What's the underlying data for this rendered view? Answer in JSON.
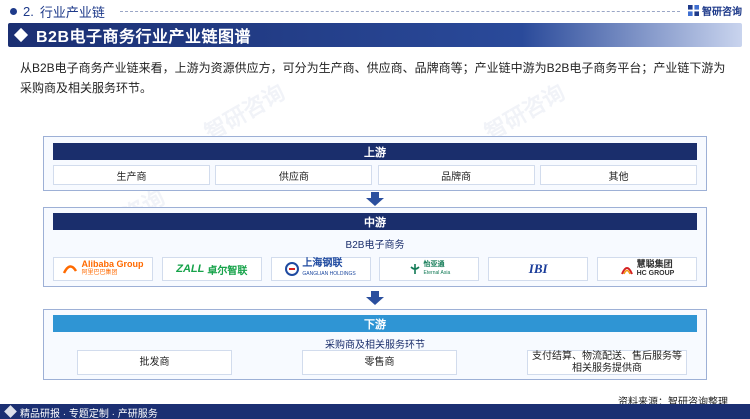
{
  "header": {
    "section_number": "2.",
    "section_title": "行业产业链",
    "brand": "智研咨询"
  },
  "title": "B2B电子商务行业产业链图谱",
  "intro": "从B2B电子商务产业链来看，上游为资源供应方，可分为生产商、供应商、品牌商等；产业链中游为B2B电子商务平台；产业链下游为采购商及相关服务环节。",
  "upstream": {
    "label": "上游",
    "items": [
      "生产商",
      "供应商",
      "品牌商",
      "其他"
    ]
  },
  "midstream": {
    "label": "中游",
    "sublabel": "B2B电子商务",
    "logos": [
      {
        "name": "Alibaba Group",
        "sub": "阿里巴巴集团",
        "color": "#ff6a00"
      },
      {
        "name": "ZALL",
        "sub": "卓尔智联",
        "color": "#17a34a"
      },
      {
        "name": "上海钢联",
        "sub": "GANGLIAN HOLDINGS",
        "color": "#1f4aa0"
      },
      {
        "name": "怡亚通",
        "sub": "Eternal Asia",
        "color": "#117a55"
      },
      {
        "name": "IBI",
        "sub": "",
        "color": "#1a3c9a"
      },
      {
        "name": "慧聪集团",
        "sub": "HC GROUP",
        "color": "#d42020"
      }
    ]
  },
  "downstream": {
    "label": "下游",
    "sublabel": "采购商及相关服务环节",
    "items": [
      "批发商",
      "零售商",
      "支付结算、物流配送、售后服务等相关服务提供商"
    ]
  },
  "source": "资料来源：智研咨询整理",
  "footer": "精品研报 · 专题定制 · 产研服务"
}
